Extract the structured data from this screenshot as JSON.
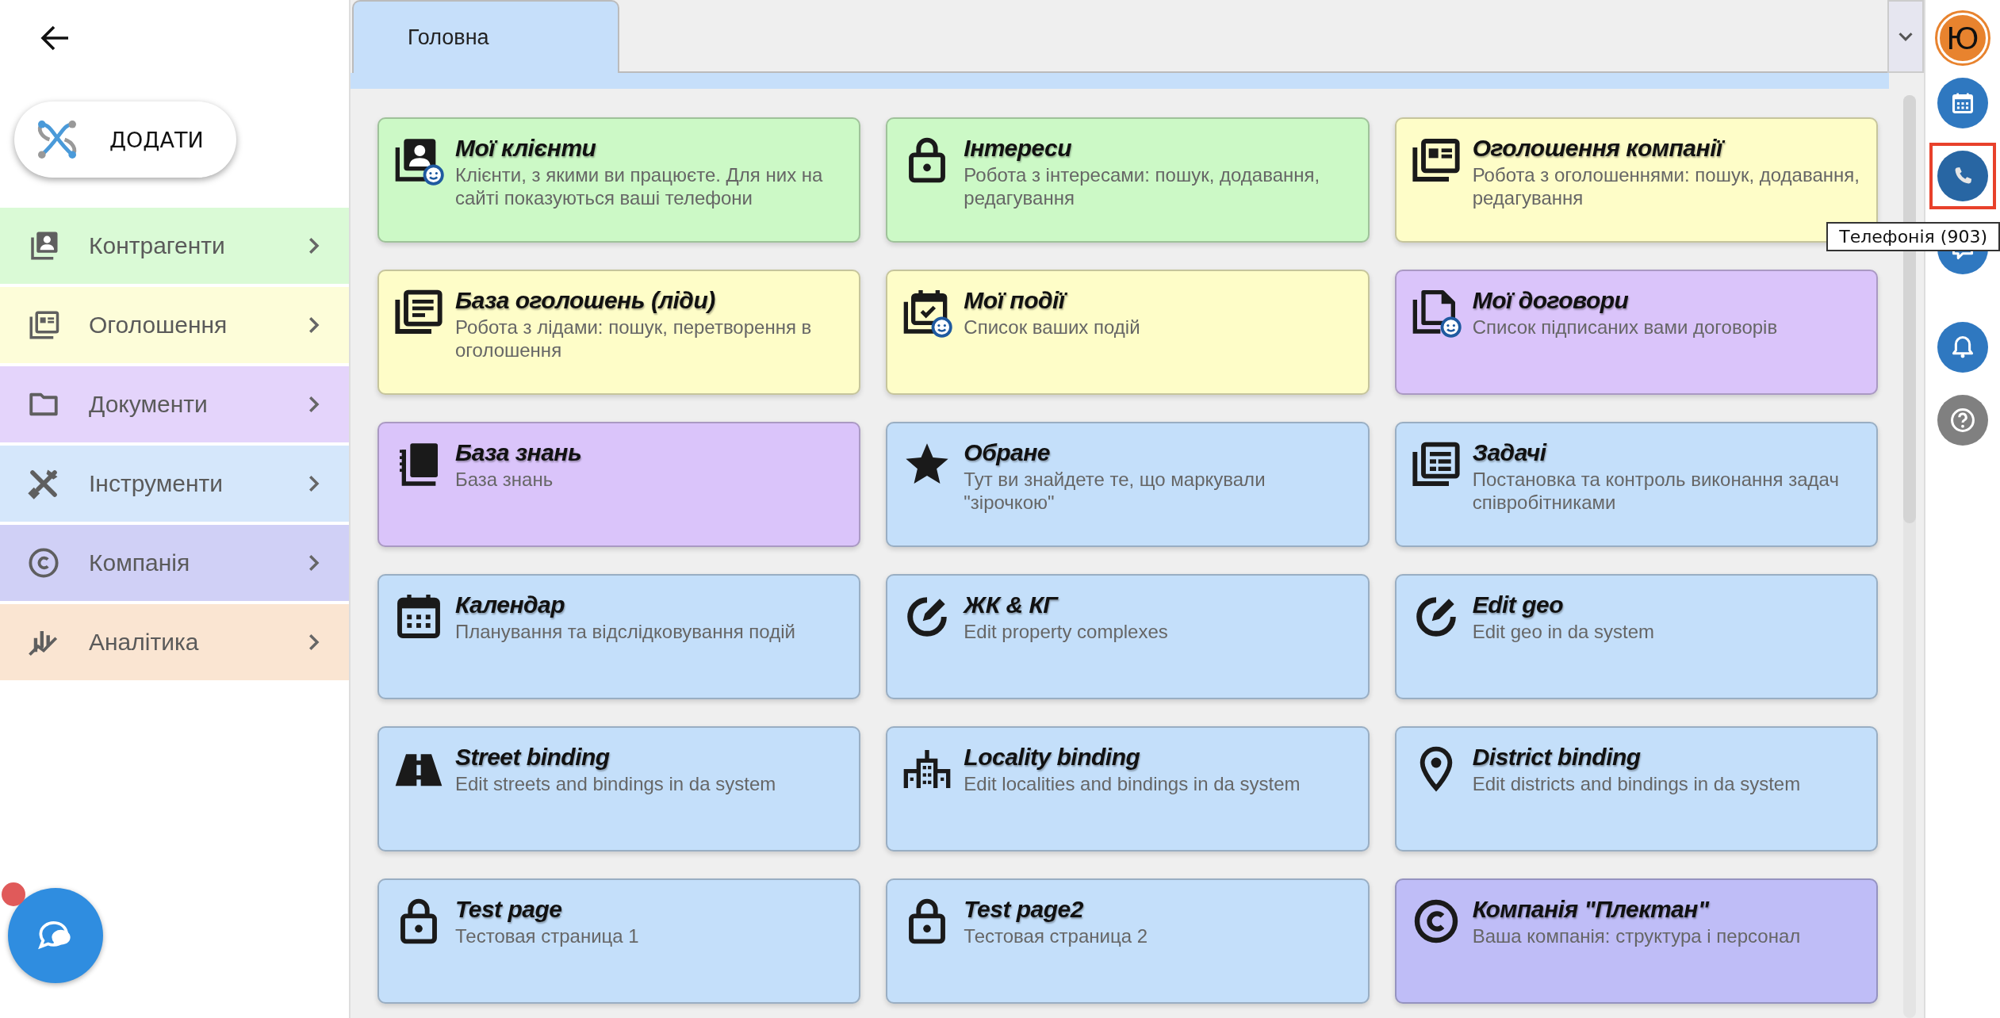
{
  "add_button": {
    "label": "ДОДАТИ"
  },
  "sidebar": {
    "items": [
      {
        "label": "Контрагенти",
        "color": "#dafad6"
      },
      {
        "label": "Оголошення",
        "color": "#fdfdd9"
      },
      {
        "label": "Документи",
        "color": "#e4d4fb"
      },
      {
        "label": "Інструменти",
        "color": "#d5e7fb"
      },
      {
        "label": "Компанія",
        "color": "#d0d0f6"
      },
      {
        "label": "Аналітика",
        "color": "#fae5d2"
      }
    ]
  },
  "tabs": [
    {
      "label": "Головна",
      "selected": true
    }
  ],
  "tiles": [
    {
      "title": "Мої клієнти",
      "description": "Клієнти, з якими ви працюєте. Для них на сайті показуються ваші телефони",
      "color": "#ccf9c6"
    },
    {
      "title": "Інтереси",
      "description": "Робота з інтересами: пошук, додавання, редагування",
      "color": "#ccf9c6"
    },
    {
      "title": "Оголошення компанії",
      "description": "Робота з оголошеннями: пошук, додавання, редагування",
      "color": "#fefdc8"
    },
    {
      "title": "База оголошень (ліди)",
      "description": "Робота з лідами: пошук, перетворення в оголошення",
      "color": "#fefdc8"
    },
    {
      "title": "Мої події",
      "description": "Список ваших подій",
      "color": "#fefdc8"
    },
    {
      "title": "Мої договори",
      "description": "Список підписаних вами договорів",
      "color": "#dac4fa"
    },
    {
      "title": "База знань",
      "description": "База знань",
      "color": "#dac4fa"
    },
    {
      "title": "Обране",
      "description": "Тут ви знайдете те, що маркували \"зірочкою\"",
      "color": "#c4dffa"
    },
    {
      "title": "Задачі",
      "description": "Постановка та контроль виконання задач співробітниками",
      "color": "#c4dffa"
    },
    {
      "title": "Календар",
      "description": "Планування та відслідковування подій",
      "color": "#c4dffa"
    },
    {
      "title": "ЖК & КГ",
      "description": "Edit property complexes",
      "color": "#c4dffa"
    },
    {
      "title": "Edit geo",
      "description": "Edit geo in da system",
      "color": "#c4dffa"
    },
    {
      "title": "Street binding",
      "description": "Edit streets and bindings in da system",
      "color": "#c4dffa"
    },
    {
      "title": "Locality binding",
      "description": "Edit localities and bindings in da system",
      "color": "#c4dffa"
    },
    {
      "title": "District binding",
      "description": "Edit districts and bindings in da system",
      "color": "#c4dffa"
    },
    {
      "title": "Test page",
      "description": "Тестовая страница 1",
      "color": "#c4dffa"
    },
    {
      "title": "Test page2",
      "description": "Тестовая страница 2",
      "color": "#c4dffa"
    },
    {
      "title": "Компанія \"Плектан\"",
      "description": "Ваша компанія: структура і персонал",
      "color": "#bfbdf7"
    }
  ],
  "rail": {
    "avatar": "Ю",
    "buttons": [
      {
        "highlighted": false
      },
      {
        "highlighted": true
      },
      {
        "highlighted": false
      },
      {
        "highlighted": false
      },
      {
        "highlighted": false
      }
    ],
    "tooltip": "Телефонія (903)"
  }
}
